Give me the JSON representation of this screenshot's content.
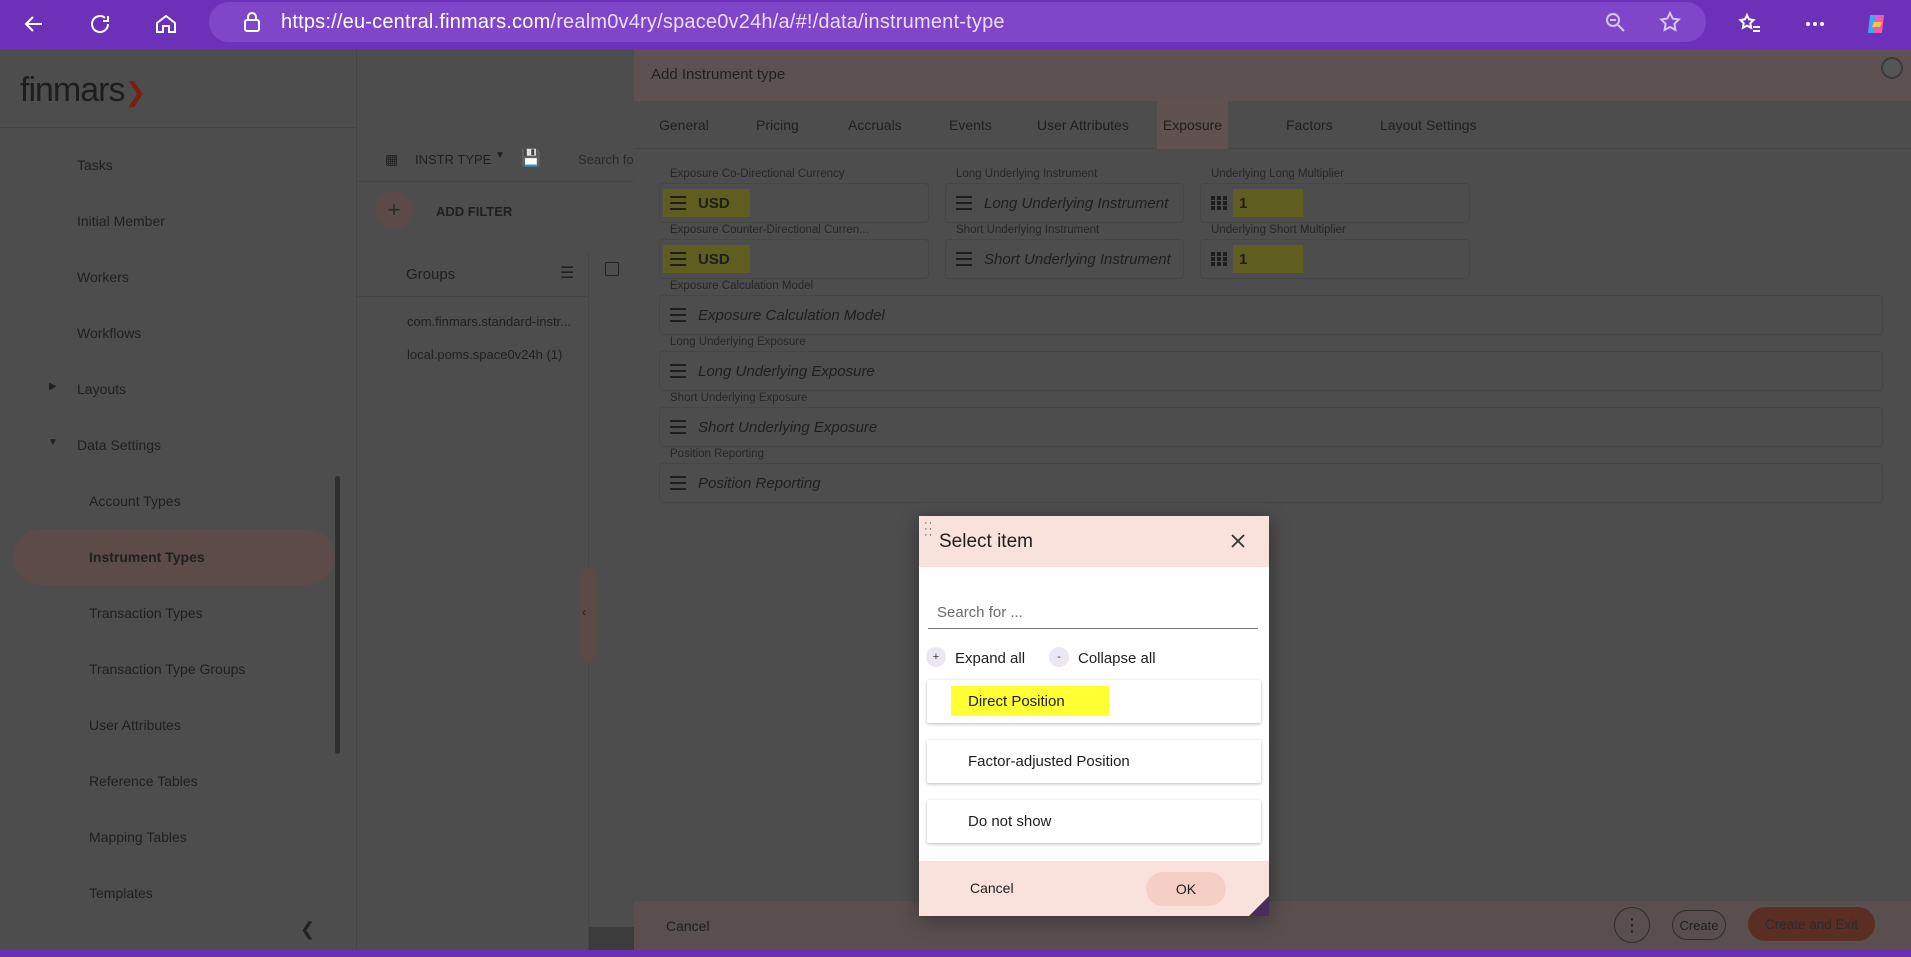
{
  "browser": {
    "url_host": "https://eu-central.finmars.com",
    "url_path": "/realm0v4ry/space0v24h/a/#!/data/instrument-type"
  },
  "logo": {
    "text": "finmars"
  },
  "nav": {
    "items": [
      {
        "label": "Tasks"
      },
      {
        "label": "Initial Member"
      },
      {
        "label": "Workers"
      },
      {
        "label": "Workflows"
      },
      {
        "label": "Layouts"
      },
      {
        "label": "Data Settings"
      },
      {
        "label": "Account Types"
      },
      {
        "label": "Instrument Types"
      },
      {
        "label": "Transaction Types"
      },
      {
        "label": "Transaction Type Groups"
      },
      {
        "label": "User Attributes"
      },
      {
        "label": "Reference Tables"
      },
      {
        "label": "Mapping Tables"
      },
      {
        "label": "Templates"
      }
    ]
  },
  "middle": {
    "layout_name": "INSTR TYPE",
    "search_placeholder": "Search fo",
    "add_filter": "ADD FILTER",
    "groups_title": "Groups",
    "groups": [
      {
        "label": "com.finmars.standard-instr..."
      },
      {
        "label": "local.poms.space0v24h (1)"
      }
    ]
  },
  "dialog": {
    "title": "Add Instrument type",
    "tabs": [
      {
        "label": "General"
      },
      {
        "label": "Pricing"
      },
      {
        "label": "Accruals"
      },
      {
        "label": "Events"
      },
      {
        "label": "User Attributes"
      },
      {
        "label": "Exposure"
      },
      {
        "label": "Factors"
      },
      {
        "label": "Layout Settings"
      }
    ],
    "active_tab": "Exposure",
    "fields": {
      "co_currency": {
        "label": "Exposure Co-Directional Currency",
        "value": "USD"
      },
      "counter_currency": {
        "label": "Exposure Counter-Directional Curren...",
        "value": "USD"
      },
      "long_instrument": {
        "label": "Long Underlying Instrument",
        "placeholder": "Long Underlying Instrument"
      },
      "short_instrument": {
        "label": "Short Underlying Instrument",
        "placeholder": "Short Underlying Instrument"
      },
      "long_multiplier": {
        "label": "Underlying Long Multiplier",
        "value": "1"
      },
      "short_multiplier": {
        "label": "Underlying Short Multiplier",
        "value": "1"
      },
      "calc_model": {
        "label": "Exposure Calculation Model",
        "placeholder": "Exposure Calculation Model"
      },
      "long_exposure": {
        "label": "Long Underlying Exposure",
        "placeholder": "Long Underlying Exposure"
      },
      "short_exposure": {
        "label": "Short Underlying Exposure",
        "placeholder": "Short Underlying Exposure"
      },
      "position_reporting": {
        "label": "Position Reporting",
        "placeholder": "Position Reporting"
      }
    },
    "footer": {
      "cancel": "Cancel",
      "create": "Create",
      "create_exit": "Create and Exit"
    }
  },
  "modal": {
    "title": "Select item",
    "search_placeholder": "Search for ...",
    "expand_all": "Expand all",
    "collapse_all": "Collapse all",
    "expand_symbol": "+",
    "collapse_symbol": "-",
    "items": [
      {
        "label": "Direct Position",
        "highlighted": true
      },
      {
        "label": "Factor-adjusted Position",
        "highlighted": false
      },
      {
        "label": "Do not show",
        "highlighted": false
      }
    ],
    "cancel": "Cancel",
    "ok": "OK"
  },
  "colors": {
    "browser_purple": "#6d30b9",
    "modal_header": "#f9e1dc",
    "highlight_yellow": "#ffff33",
    "create_exit_brown": "#5a2e22"
  }
}
